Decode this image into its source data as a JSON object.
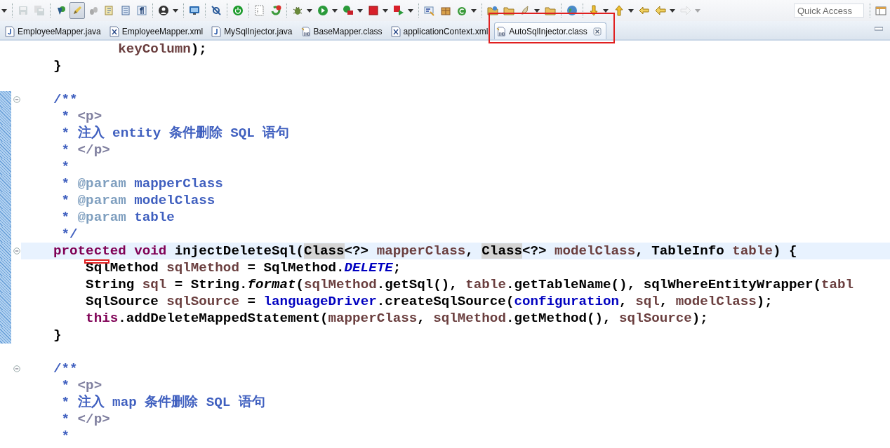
{
  "toolbar": {
    "save_disabled": true,
    "mark_occurrences_on": true,
    "forward_disabled": true,
    "quick_access": {
      "placeholder": "Quick Access"
    }
  },
  "tabs": [
    {
      "label": "EmployeeMapper.java",
      "kind": "java",
      "selected": false,
      "highlighted": false
    },
    {
      "label": "EmployeeMapper.xml",
      "kind": "xml",
      "selected": false,
      "highlighted": false
    },
    {
      "label": "MySqlInjector.java",
      "kind": "java",
      "selected": false,
      "highlighted": false
    },
    {
      "label": "BaseMapper.class",
      "kind": "class",
      "selected": false,
      "highlighted": false
    },
    {
      "label": "applicationContext.xml",
      "kind": "xml",
      "selected": false,
      "highlighted": false
    },
    {
      "label": "AutoSqlInjector.class",
      "kind": "class",
      "selected": true,
      "highlighted": true
    }
  ],
  "editor": {
    "lines": [
      {
        "current": false,
        "foldable": false,
        "changed": false,
        "marked": false,
        "tokens": [
          {
            "kind": "local",
            "text": "            keyColumn"
          },
          {
            "kind": "plain",
            "text": ");"
          }
        ]
      },
      {
        "current": false,
        "foldable": false,
        "changed": false,
        "marked": false,
        "tokens": [
          {
            "kind": "plain",
            "text": "    }"
          }
        ]
      },
      {
        "current": false,
        "foldable": false,
        "changed": false,
        "marked": false
      },
      {
        "current": false,
        "foldable": true,
        "changed": true,
        "marked": false,
        "tokens": [
          {
            "kind": "doc",
            "text": "    /**"
          }
        ]
      },
      {
        "current": false,
        "foldable": false,
        "changed": true,
        "marked": false,
        "tokens": [
          {
            "kind": "doc",
            "text": "     * "
          },
          {
            "kind": "doc-html",
            "text": "<p>"
          }
        ]
      },
      {
        "current": false,
        "foldable": false,
        "changed": true,
        "marked": false,
        "tokens": [
          {
            "kind": "doc",
            "text": "     * 注入 entity 条件删除 SQL 语句"
          }
        ]
      },
      {
        "current": false,
        "foldable": false,
        "changed": true,
        "marked": false,
        "tokens": [
          {
            "kind": "doc",
            "text": "     * "
          },
          {
            "kind": "doc-html",
            "text": "</p>"
          }
        ]
      },
      {
        "current": false,
        "foldable": false,
        "changed": true,
        "marked": false,
        "tokens": [
          {
            "kind": "doc",
            "text": "     *"
          }
        ]
      },
      {
        "current": false,
        "foldable": false,
        "changed": true,
        "marked": false,
        "tokens": [
          {
            "kind": "doc",
            "text": "     * "
          },
          {
            "kind": "doc-tag",
            "text": "@param"
          },
          {
            "kind": "doc",
            "text": " mapperClass"
          }
        ]
      },
      {
        "current": false,
        "foldable": false,
        "changed": true,
        "marked": false,
        "tokens": [
          {
            "kind": "doc",
            "text": "     * "
          },
          {
            "kind": "doc-tag",
            "text": "@param"
          },
          {
            "kind": "doc",
            "text": " modelClass"
          }
        ]
      },
      {
        "current": false,
        "foldable": false,
        "changed": true,
        "marked": false,
        "tokens": [
          {
            "kind": "doc",
            "text": "     * "
          },
          {
            "kind": "doc-tag",
            "text": "@param"
          },
          {
            "kind": "doc",
            "text": " table"
          }
        ]
      },
      {
        "current": false,
        "foldable": false,
        "changed": true,
        "marked": false,
        "tokens": [
          {
            "kind": "doc",
            "text": "     */"
          }
        ]
      },
      {
        "current": true,
        "foldable": true,
        "changed": true,
        "marked": false,
        "tokens": [
          {
            "kind": "keyword",
            "text": "    protected"
          },
          {
            "kind": "keyword",
            "text": " void"
          },
          {
            "kind": "plain",
            "text": " injectDeleteSql("
          },
          {
            "kind": "occurrence",
            "text": "Class"
          },
          {
            "kind": "plain",
            "text": "<?> "
          },
          {
            "kind": "local",
            "text": "mapperClass"
          },
          {
            "kind": "plain",
            "text": ", "
          },
          {
            "kind": "occurrence",
            "text": "Class"
          },
          {
            "kind": "plain",
            "text": "<?> "
          },
          {
            "kind": "local",
            "text": "modelClass"
          },
          {
            "kind": "plain",
            "text": ", TableInfo "
          },
          {
            "kind": "local",
            "text": "table"
          },
          {
            "kind": "plain",
            "text": ") {"
          }
        ]
      },
      {
        "current": false,
        "foldable": false,
        "changed": true,
        "marked": true,
        "tokens": [
          {
            "kind": "plain",
            "text": "        SqlMethod "
          },
          {
            "kind": "local",
            "text": "sqlMethod"
          },
          {
            "kind": "plain",
            "text": " = SqlMethod."
          },
          {
            "kind": "constant",
            "text": "DELETE"
          },
          {
            "kind": "plain",
            "text": ";"
          }
        ]
      },
      {
        "current": false,
        "foldable": false,
        "changed": true,
        "marked": false,
        "tokens": [
          {
            "kind": "plain",
            "text": "        String "
          },
          {
            "kind": "local",
            "text": "sql"
          },
          {
            "kind": "plain",
            "text": " = String."
          },
          {
            "kind": "static",
            "text": "format"
          },
          {
            "kind": "plain",
            "text": "("
          },
          {
            "kind": "local",
            "text": "sqlMethod"
          },
          {
            "kind": "plain",
            "text": ".getSql(), "
          },
          {
            "kind": "local",
            "text": "table"
          },
          {
            "kind": "plain",
            "text": ".getTableName(), sqlWhereEntityWrapper("
          },
          {
            "kind": "local",
            "text": "tabl"
          }
        ]
      },
      {
        "current": false,
        "foldable": false,
        "changed": true,
        "marked": false,
        "tokens": [
          {
            "kind": "plain",
            "text": "        SqlSource "
          },
          {
            "kind": "local",
            "text": "sqlSource"
          },
          {
            "kind": "plain",
            "text": " = "
          },
          {
            "kind": "field",
            "text": "languageDriver"
          },
          {
            "kind": "plain",
            "text": ".createSqlSource("
          },
          {
            "kind": "field",
            "text": "configuration"
          },
          {
            "kind": "plain",
            "text": ", "
          },
          {
            "kind": "local",
            "text": "sql"
          },
          {
            "kind": "plain",
            "text": ", "
          },
          {
            "kind": "local",
            "text": "modelClass"
          },
          {
            "kind": "plain",
            "text": ");"
          }
        ]
      },
      {
        "current": false,
        "foldable": false,
        "changed": true,
        "marked": false,
        "tokens": [
          {
            "kind": "keyword",
            "text": "        this"
          },
          {
            "kind": "plain",
            "text": ".addDeleteMappedStatement("
          },
          {
            "kind": "local",
            "text": "mapperClass"
          },
          {
            "kind": "plain",
            "text": ", "
          },
          {
            "kind": "local",
            "text": "sqlMethod"
          },
          {
            "kind": "plain",
            "text": ".getMethod(), "
          },
          {
            "kind": "local",
            "text": "sqlSource"
          },
          {
            "kind": "plain",
            "text": ");"
          }
        ]
      },
      {
        "current": false,
        "foldable": false,
        "changed": true,
        "marked": false,
        "tokens": [
          {
            "kind": "plain",
            "text": "    }"
          }
        ]
      },
      {
        "current": false,
        "foldable": false,
        "changed": false,
        "marked": false
      },
      {
        "current": false,
        "foldable": true,
        "changed": false,
        "marked": false,
        "tokens": [
          {
            "kind": "doc",
            "text": "    /**"
          }
        ]
      },
      {
        "current": false,
        "foldable": false,
        "changed": false,
        "marked": false,
        "tokens": [
          {
            "kind": "doc",
            "text": "     * "
          },
          {
            "kind": "doc-html",
            "text": "<p>"
          }
        ]
      },
      {
        "current": false,
        "foldable": false,
        "changed": false,
        "marked": false,
        "tokens": [
          {
            "kind": "doc",
            "text": "     * 注入 map 条件删除 SQL 语句"
          }
        ]
      },
      {
        "current": false,
        "foldable": false,
        "changed": false,
        "marked": false,
        "tokens": [
          {
            "kind": "doc",
            "text": "     * "
          },
          {
            "kind": "doc-html",
            "text": "</p>"
          }
        ]
      },
      {
        "current": false,
        "foldable": false,
        "changed": false,
        "marked": false,
        "tokens": [
          {
            "kind": "doc",
            "text": "     *"
          }
        ]
      }
    ]
  }
}
